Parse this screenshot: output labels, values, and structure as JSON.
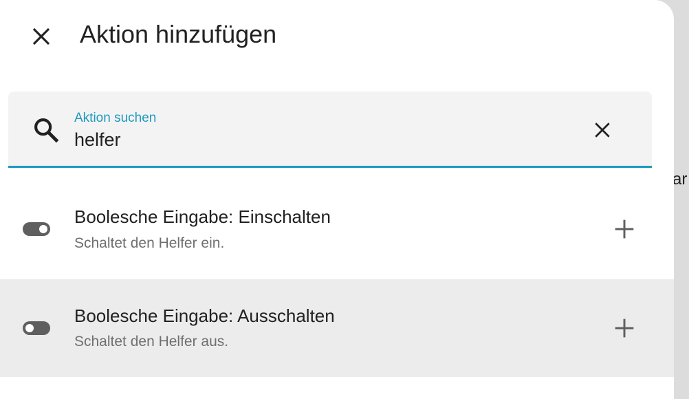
{
  "dialog": {
    "title": "Aktion hinzufügen",
    "close_icon": "close-icon"
  },
  "search": {
    "label": "Aktion suchen",
    "value": "helfer",
    "search_icon": "magnify-icon",
    "clear_icon": "close-icon",
    "accent_color": "#1e9ac0"
  },
  "results": [
    {
      "title": "Boolesche Eingabe: Einschalten",
      "subtitle": "Schaltet den Helfer ein.",
      "icon": "toggle-switch-on-icon",
      "action_icon": "plus-icon"
    },
    {
      "title": "Boolesche Eingabe: Ausschalten",
      "subtitle": "Schaltet den Helfer aus.",
      "icon": "toggle-switch-off-icon",
      "action_icon": "plus-icon",
      "selected": true
    }
  ],
  "background": {
    "partial_text": "ar"
  }
}
